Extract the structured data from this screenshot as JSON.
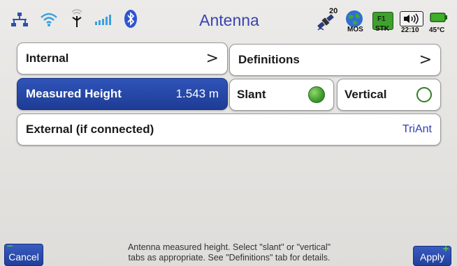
{
  "status": {
    "title": "Antenna",
    "satellites_count": "20",
    "mos_label": "MOS",
    "f1_label": "F1",
    "stk_label": "STK",
    "time": "22:10",
    "temperature": "45°C"
  },
  "rows": {
    "internal_label": "Internal",
    "definitions_label": "Definitions",
    "measured_height_label": "Measured Height",
    "measured_height_value": "1.543 m",
    "slant_label": "Slant",
    "vertical_label": "Vertical",
    "external_label": "External (if connected)",
    "external_value": "TriAnt"
  },
  "help": {
    "line1": "Antenna measured height. Select \"slant\" or \"vertical\"",
    "line2": "tabs as appropriate. See \"Definitions\" tab for details."
  },
  "buttons": {
    "cancel": "Cancel",
    "apply": "Apply"
  },
  "selection": {
    "slant_selected": true,
    "vertical_selected": false
  },
  "colors": {
    "accent_blue": "#2f54b8",
    "title_blue": "#3a44b0",
    "radio_green": "#3f9a2c"
  }
}
